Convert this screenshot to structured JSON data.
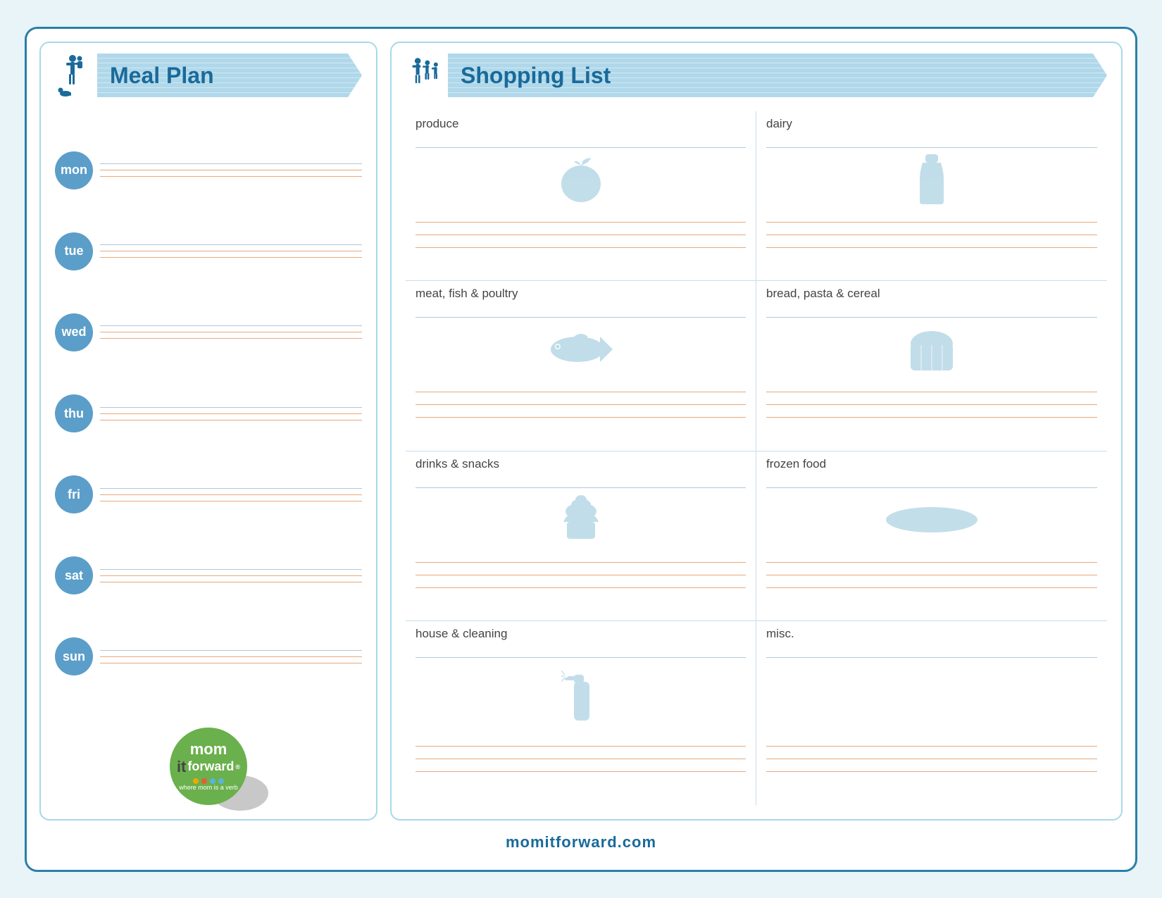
{
  "page": {
    "background_color": "#d0eaf5",
    "border_color": "#2a7fa8"
  },
  "meal_plan": {
    "title": "Meal Plan",
    "days": [
      {
        "abbr": "mon"
      },
      {
        "abbr": "tue"
      },
      {
        "abbr": "wed"
      },
      {
        "abbr": "thu"
      },
      {
        "abbr": "fri"
      },
      {
        "abbr": "sat"
      },
      {
        "abbr": "sun"
      }
    ]
  },
  "shopping_list": {
    "title": "Shopping List",
    "sections": [
      {
        "id": "produce",
        "label": "produce",
        "icon": "apple"
      },
      {
        "id": "dairy",
        "label": "dairy",
        "icon": "bottle"
      },
      {
        "id": "meat",
        "label": "meat, fish & poultry",
        "icon": "fish"
      },
      {
        "id": "bread",
        "label": "bread, pasta & cereal",
        "icon": "bread"
      },
      {
        "id": "drinks",
        "label": "drinks & snacks",
        "icon": "cupcake"
      },
      {
        "id": "frozen",
        "label": "frozen food",
        "icon": "frozen"
      },
      {
        "id": "house",
        "label": "house & cleaning",
        "icon": "spray"
      },
      {
        "id": "misc",
        "label": "misc.",
        "icon": "misc"
      }
    ]
  },
  "logo": {
    "line1": "mom",
    "line2": "it forward",
    "trademark": "®",
    "tagline": "where mom is a verb",
    "dots": [
      "#f0a800",
      "#e85c3a",
      "#5ab4d8",
      "#5ab4d8"
    ]
  },
  "footer": {
    "text": "momitforward.com"
  }
}
